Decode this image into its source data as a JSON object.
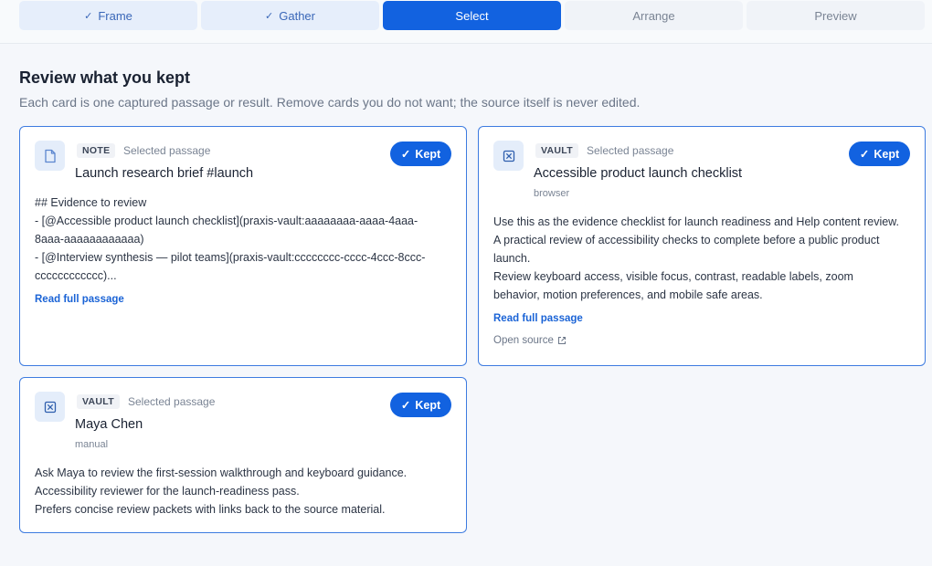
{
  "stepper": {
    "steps": [
      {
        "label": "Frame",
        "state": "done"
      },
      {
        "label": "Gather",
        "state": "done"
      },
      {
        "label": "Select",
        "state": "active"
      },
      {
        "label": "Arrange",
        "state": "todo"
      },
      {
        "label": "Preview",
        "state": "todo"
      }
    ],
    "check": "✓"
  },
  "page": {
    "title": "Review what you kept",
    "subtitle": "Each card is one captured passage or result. Remove cards you do not want; the source itself is never edited."
  },
  "cards": [
    {
      "tag": "NOTE",
      "kind": "Selected passage",
      "title": "Launch research brief #launch",
      "kept_label": "Kept",
      "body": [
        "## Evidence to review",
        "- [@Accessible product launch checklist](praxis-vault:aaaaaaaa-aaaa-4aaa-",
        "8aaa-aaaaaaaaaaaa)",
        "- [@Interview synthesis — pilot teams](praxis-vault:cccccccc-cccc-4ccc-8ccc-",
        "cccccccccccc)..."
      ],
      "link": "Read full passage",
      "icon": "document-icon"
    },
    {
      "tag": "VAULT",
      "kind": "Selected passage",
      "title": "Accessible product launch checklist",
      "meta": "browser",
      "kept_label": "Kept",
      "body": [
        "Use this as the evidence checklist for launch readiness and Help content review.",
        "A practical review of accessibility checks to complete before a public product",
        "launch.",
        "Review keyboard access, visible focus, contrast, readable labels, zoom",
        "behavior, motion preferences, and mobile safe areas."
      ],
      "link": "Read full passage",
      "source": "Open source",
      "icon": "vault-icon"
    },
    {
      "tag": "VAULT",
      "kind": "Selected passage",
      "title": "Maya Chen",
      "meta": "manual",
      "kept_label": "Kept",
      "body": [
        "Ask Maya to review the first-session walkthrough and keyboard guidance.",
        "Accessibility reviewer for the launch-readiness pass.",
        "Prefers concise review packets with links back to the source material."
      ],
      "icon": "vault-icon"
    }
  ],
  "colors": {
    "accent": "#1262e0",
    "card_border": "#3d7be0",
    "link": "#1a63d6"
  }
}
